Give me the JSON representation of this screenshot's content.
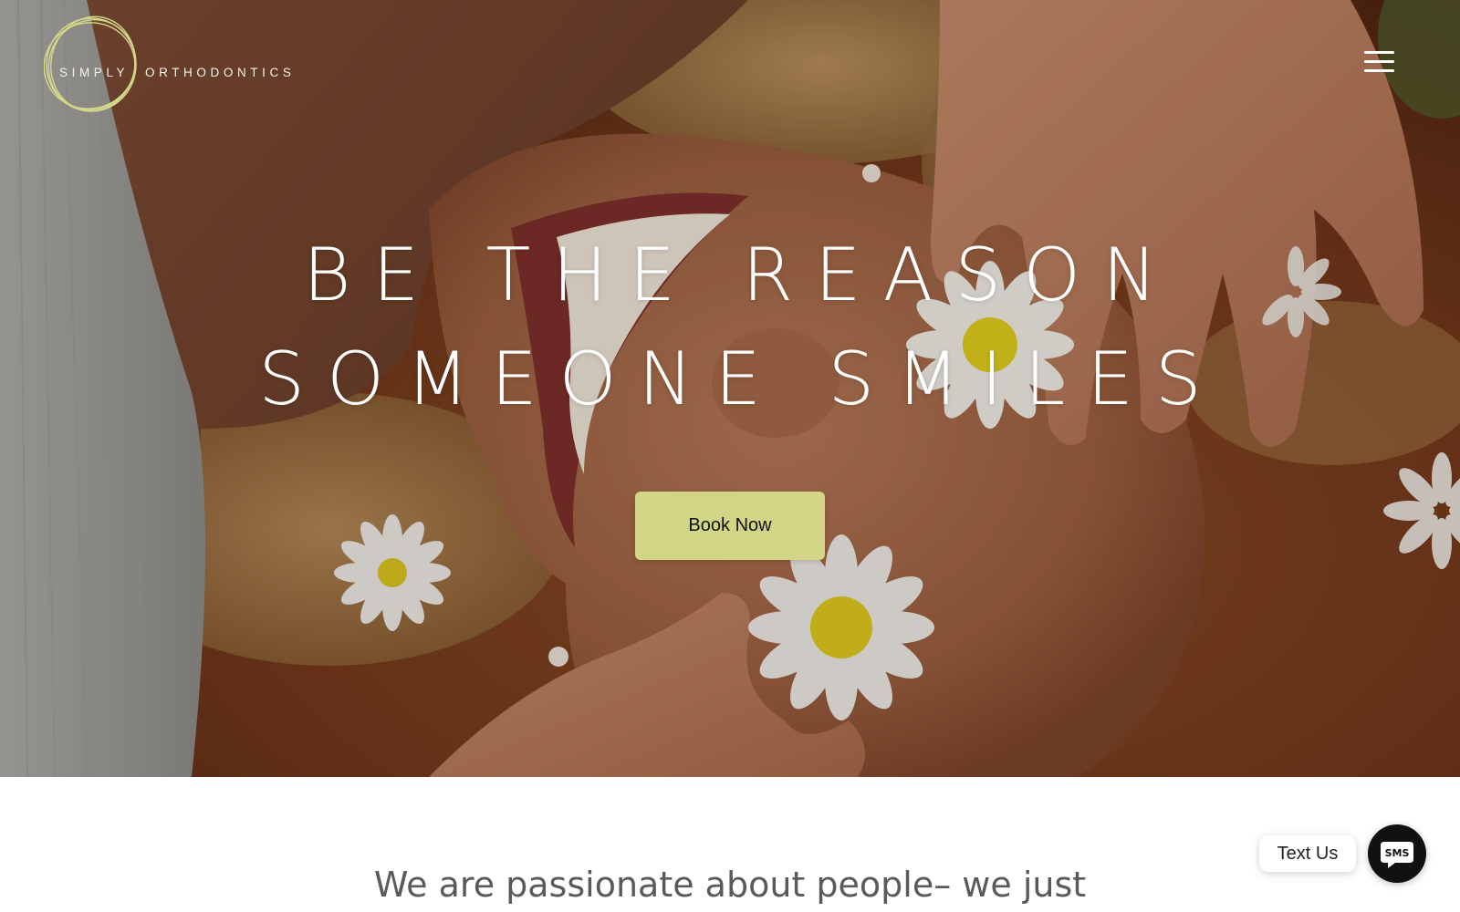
{
  "brand": {
    "name_part1": "SIMPLY",
    "name_part2": "ORTHODONTICS",
    "logo_ring_color": "#d4d98a"
  },
  "header": {
    "menu_icon": "hamburger-menu-icon"
  },
  "hero": {
    "headline_line1": "BE THE REASON",
    "headline_line2": "SOMEONE SMILES",
    "cta_label": "Book Now",
    "cta_color": "#d1d585"
  },
  "intro": {
    "text": "We are passionate about people– we just"
  },
  "sms_widget": {
    "label": "Text Us",
    "icon_text": "SMS",
    "icon": "sms-chat-bubble-icon"
  }
}
